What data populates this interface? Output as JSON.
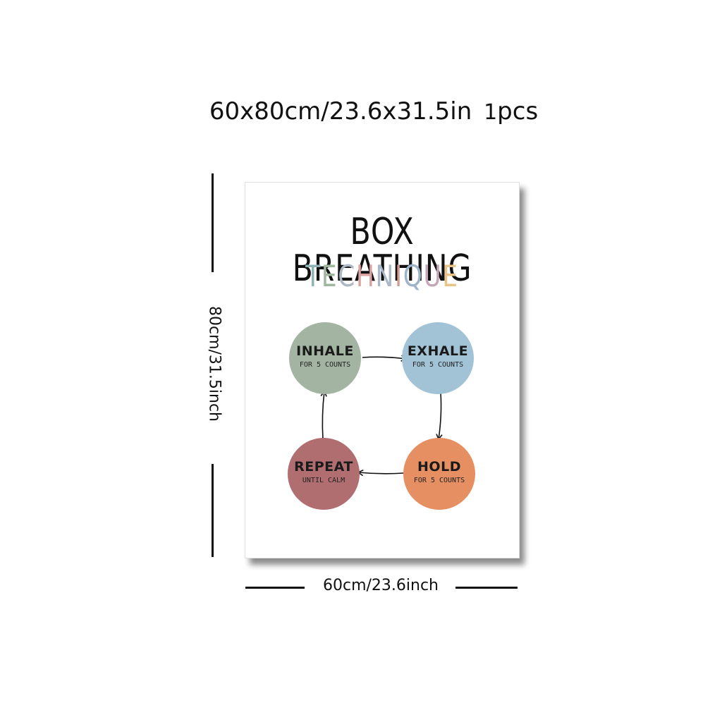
{
  "header": {
    "size": "60x80cm/23.6x31.5in",
    "count": "1",
    "unit": "pcs"
  },
  "dimensions": {
    "height_label": "80cm/31.5inch",
    "width_label": "60cm/23.6inch"
  },
  "poster": {
    "title": "BOX BREATHING",
    "subtitle_letters": [
      "T",
      "E",
      "C",
      "H",
      "N",
      "I",
      "Q",
      "U",
      "E"
    ],
    "subtitle_colors": [
      "#8fb3b5",
      "#9fb79e",
      "#aeb7c4",
      "#d8a3a0",
      "#a9b7c9",
      "#d49b94",
      "#9db3c9",
      "#c3a7b8",
      "#e8c587"
    ],
    "steps": [
      {
        "title": "INHALE",
        "text": "FOR 5 COUNTS",
        "color": "#a3b5a2"
      },
      {
        "title": "EXHALE",
        "text": "FOR 5 COUNTS",
        "color": "#a2c3d6"
      },
      {
        "title": "HOLD",
        "text": "FOR 5 COUNTS",
        "color": "#e58f62"
      },
      {
        "title": "REPEAT",
        "text": "UNTIL CALM",
        "color": "#b16e70"
      }
    ]
  }
}
